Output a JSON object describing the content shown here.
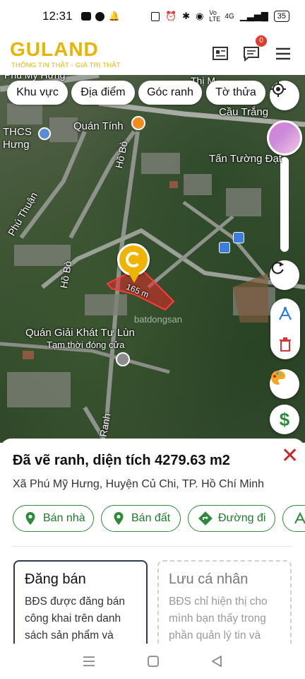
{
  "status": {
    "time": "12:31",
    "battery": "35",
    "network": "4G",
    "volte": "Vo LTE"
  },
  "header": {
    "logo": "GULAND",
    "tagline": "THÔNG TIN THẬT - GIÁ TRỊ THẬT",
    "notification_count": "0",
    "brand_color": "#e9b300"
  },
  "map": {
    "filters": [
      "Khu vực",
      "Địa điểm",
      "Góc ranh",
      "Tờ thửa"
    ],
    "labels": {
      "school": "THCS\nHưng",
      "quan_tinh": "Quán Tính",
      "ho_bo_1": "Hồ Bò",
      "ho_bo_2": "Hồ Bò",
      "phu_thuan": "Phú Thuận",
      "cau_trang": "Cầu Trắng",
      "tan_tuong": "Tấn Tường Đạt",
      "quan_giai_khat": "Quán Giải Khát Tư Lùn",
      "tam_thoi": "Tạm thời đóng cửa",
      "watermark": "batdongsan",
      "ranh": "Ranh",
      "my_hung": "Phú Mỹ Hưng",
      "thi_m": "Thị M",
      "parcel_len": "165 m"
    }
  },
  "sheet": {
    "title": "Đã vẽ ranh, diện tích 4279.63 m2",
    "address": "Xã Phú Mỹ Hưng, Huyện Củ Chi, TP. Hồ Chí Minh",
    "actions": [
      "Bán nhà",
      "Bán đất",
      "Đường đi"
    ],
    "card_post": {
      "title": "Đăng bán",
      "desc": "BĐS được đăng bán công khai trên danh sách sản phẩm và"
    },
    "card_save": {
      "title": "Lưu cá nhân",
      "desc": "BĐS chỉ hiện thị cho mình bạn thấy trong phần quản lý tin và"
    },
    "accent_color": "#2e8b3a",
    "close_color": "#c62828"
  }
}
